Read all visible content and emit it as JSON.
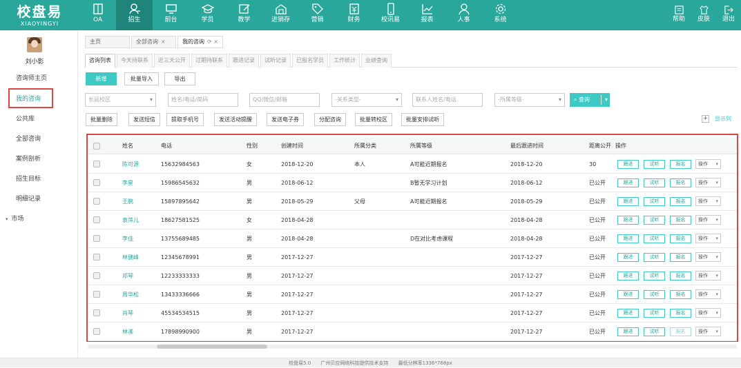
{
  "logo": {
    "cn": "校盘易",
    "en": "XIAOYINGYI"
  },
  "nav": [
    {
      "label": "OA",
      "icon": "book-icon"
    },
    {
      "label": "招生",
      "icon": "user-icon",
      "active": true
    },
    {
      "label": "前台",
      "icon": "monitor-icon"
    },
    {
      "label": "学员",
      "icon": "graduation-cap-icon"
    },
    {
      "label": "教学",
      "icon": "edit-icon"
    },
    {
      "label": "进销存",
      "icon": "warehouse-icon"
    },
    {
      "label": "营销",
      "icon": "tag-icon"
    },
    {
      "label": "财务",
      "icon": "finance-icon"
    },
    {
      "label": "校讯易",
      "icon": "mobile-icon"
    },
    {
      "label": "报表",
      "icon": "chart-icon"
    },
    {
      "label": "人事",
      "icon": "users-icon"
    },
    {
      "label": "系统",
      "icon": "gear-icon"
    }
  ],
  "right_nav": [
    {
      "label": "帮助",
      "icon": "help-icon"
    },
    {
      "label": "皮肤",
      "icon": "shirt-icon"
    },
    {
      "label": "退出",
      "icon": "logout-icon"
    }
  ],
  "sidebar": {
    "username": "刘小影",
    "items": [
      {
        "label": "咨询师主页"
      },
      {
        "label": "我的咨询",
        "active": true
      },
      {
        "label": "公共库"
      },
      {
        "label": "全部咨询"
      },
      {
        "label": "案例剖析"
      },
      {
        "label": "招生目标"
      },
      {
        "label": "明细记录"
      },
      {
        "label": "市场",
        "caret": "▾"
      }
    ]
  },
  "tabs": [
    {
      "label": "主页"
    },
    {
      "label": "全部咨询",
      "close": "×"
    },
    {
      "label": "我的咨询",
      "close": "⟳ ×",
      "active": true
    }
  ],
  "subtabs": [
    "咨询列表",
    "今天待联系",
    "近三天公开",
    "过期待联系",
    "跟进记录",
    "试听记录",
    "已报名学员",
    "工作统计",
    "业绩查询"
  ],
  "toolbar": {
    "new": "新增",
    "import": "批量导入",
    "export": "导出"
  },
  "filters": {
    "campus": "长延校区",
    "name_phone": "姓名/电话/简码",
    "qq_wechat": "QQ/微信/邮箱",
    "relation": "-关系类型-",
    "contact": "联系人姓名/电话",
    "level": "-所属等级-",
    "search": "查询"
  },
  "actions": [
    "批量删除",
    "发送短信",
    "提取手机号",
    "发送活动提醒",
    "发送电子券",
    "分配咨询",
    "批量转校区",
    "批量安排试听"
  ],
  "show_columns": "显示列",
  "show_columns_plus": "+",
  "table": {
    "headers": {
      "name": "姓名",
      "phone": "电话",
      "gender": "性别",
      "created": "创建时间",
      "category": "所属分类",
      "level": "所属等级",
      "last_follow": "最后跟进时间",
      "distance": "距离公开",
      "ops": "操作"
    },
    "row_buttons": {
      "follow": "跟进",
      "trial": "试听",
      "signup": "报名",
      "ops": "操作"
    },
    "rows": [
      {
        "name": "陈可源",
        "phone": "15632984563",
        "gender": "女",
        "created": "2018-12-20",
        "category": "本人",
        "level": "A可能近期报名",
        "last": "2018-12-20",
        "dist": "30"
      },
      {
        "name": "李星",
        "phone": "15986545632",
        "gender": "男",
        "created": "2018-06-12",
        "category": "",
        "level": "B暂无学习计划",
        "last": "2018-06-12",
        "dist": "已公开"
      },
      {
        "name": "王鹏",
        "phone": "15897895642",
        "gender": "男",
        "created": "2018-05-29",
        "category": "父母",
        "level": "A可能近期报名",
        "last": "2018-05-29",
        "dist": "已公开"
      },
      {
        "name": "袁萍儿",
        "phone": "18627581525",
        "gender": "女",
        "created": "2018-04-28",
        "category": "",
        "level": "",
        "last": "2018-04-28",
        "dist": "已公开"
      },
      {
        "name": "李佳",
        "phone": "13755689485",
        "gender": "男",
        "created": "2018-04-28",
        "category": "",
        "level": "D在对比考虑课程",
        "last": "2018-04-28",
        "dist": "已公开"
      },
      {
        "name": "林健峰",
        "phone": "12345678991",
        "gender": "男",
        "created": "2017-12-27",
        "category": "",
        "level": "",
        "last": "2017-12-27",
        "dist": "已公开"
      },
      {
        "name": "邓琴",
        "phone": "12233333333",
        "gender": "男",
        "created": "2017-12-27",
        "category": "",
        "level": "",
        "last": "2017-12-27",
        "dist": "已公开"
      },
      {
        "name": "周华松",
        "phone": "13433336666",
        "gender": "男",
        "created": "2017-12-27",
        "category": "",
        "level": "",
        "last": "2017-12-27",
        "dist": "已公开"
      },
      {
        "name": "肖琴",
        "phone": "45534534515",
        "gender": "男",
        "created": "2017-12-27",
        "category": "",
        "level": "",
        "last": "2017-12-27",
        "dist": "已公开"
      },
      {
        "name": "林漾",
        "phone": "17898990900",
        "gender": "男",
        "created": "2017-12-27",
        "category": "",
        "level": "",
        "last": "2017-12-27",
        "dist": "已公开"
      }
    ]
  },
  "footer": {
    "version": "校盘易5.0",
    "support": "广州贝应网络科技提供技术支持",
    "resolution": "最低分辨率1336*768px"
  },
  "colors": {
    "brand": "#2aa79b",
    "accent": "#3ec9c4",
    "highlight": "#e04545"
  }
}
